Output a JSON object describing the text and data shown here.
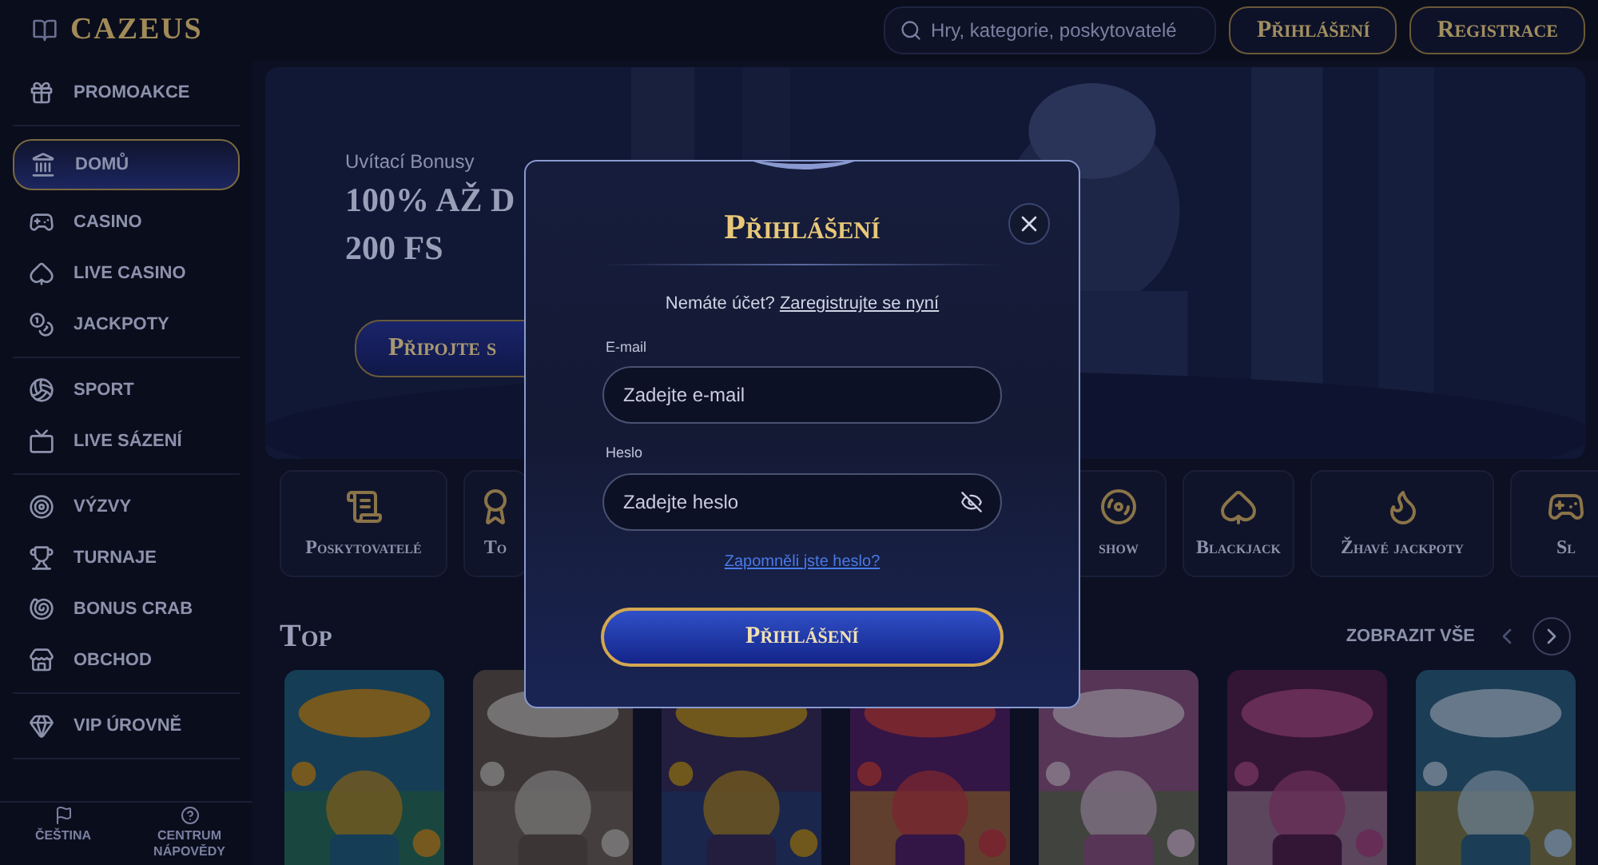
{
  "header": {
    "logo": "CAZEUS",
    "search": {
      "placeholder": "Hry, kategorie, poskytovatelé"
    },
    "buttons": [
      "Přihlášení",
      "Registrace"
    ]
  },
  "sidebar": {
    "sections": [
      [
        {
          "label": "PROMOAKCE",
          "selected": false
        }
      ],
      [
        {
          "label": "DOMŮ",
          "selected": true
        },
        {
          "label": "CASINO",
          "selected": false
        },
        {
          "label": "LIVE CASINO",
          "selected": false
        },
        {
          "label": "JACKPOTY",
          "selected": false
        }
      ],
      [
        {
          "label": "SPORT",
          "selected": false
        },
        {
          "label": "LIVE SÁZENÍ",
          "selected": false
        }
      ],
      [
        {
          "label": "VÝZVY",
          "selected": false
        },
        {
          "label": "TURNAJE",
          "selected": false
        },
        {
          "label": "BONUS CRAB",
          "selected": false
        },
        {
          "label": "OBCHOD",
          "selected": false
        }
      ],
      [
        {
          "label": "VIP ÚROVNĚ",
          "selected": false
        }
      ]
    ],
    "footer": [
      "ČEŠTINA",
      "CENTRUM NÁPOVĚDY"
    ]
  },
  "hero": {
    "subtitle": "Uvítací Bonusy",
    "title_lines": [
      "100% AŽ D",
      "200 FS"
    ],
    "button": "Připojte s"
  },
  "categories": [
    "Poskytovatelé",
    "To",
    "show",
    "Blackjack",
    "Žhavé jackpoty",
    "Sl"
  ],
  "top": {
    "title": "Top",
    "view_all": "ZOBRAZIT VŠE"
  },
  "modal": {
    "title": "Přihlášení",
    "prompt": "Nemáte účet?",
    "register_link": "Zaregistrujte se nyní",
    "fields": [
      {
        "label": "E-mail",
        "placeholder": "Zadejte e-mail",
        "kind": "text"
      },
      {
        "label": "Heslo",
        "placeholder": "Zadejte heslo",
        "kind": "password"
      }
    ],
    "forgot_link": "Zapomněli jste heslo?",
    "submit": "Přihlášení"
  }
}
